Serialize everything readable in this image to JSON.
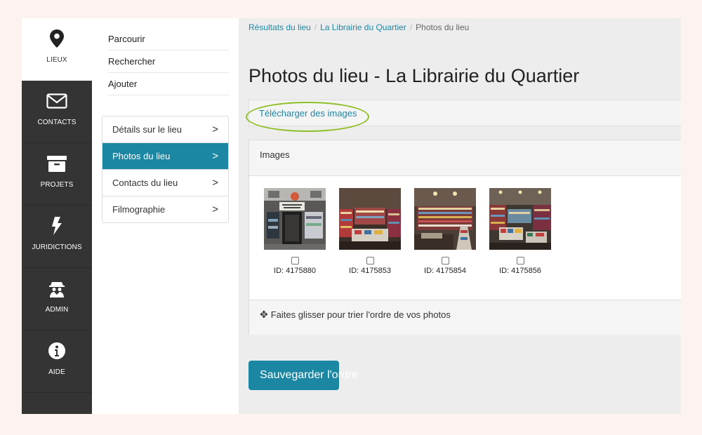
{
  "rail": {
    "items": [
      {
        "label": "LIEUX",
        "icon": "map-pin-icon",
        "active": true
      },
      {
        "label": "CONTACTS",
        "icon": "envelope-icon"
      },
      {
        "label": "PROJETS",
        "icon": "archive-box-icon"
      },
      {
        "label": "JURIDICTIONS",
        "icon": "lightning-bolt-icon"
      },
      {
        "label": "ADMIN",
        "icon": "spy-user-icon"
      },
      {
        "label": "AIDE",
        "icon": "info-circle-icon"
      }
    ]
  },
  "subnav": {
    "top_links": [
      "Parcourir",
      "Rechercher",
      "Ajouter"
    ],
    "menu": [
      {
        "label": "Détails sur le lieu"
      },
      {
        "label": "Photos du lieu",
        "active": true
      },
      {
        "label": "Contacts du lieu"
      },
      {
        "label": "Filmographie"
      }
    ],
    "chevron": ">"
  },
  "breadcrumb": {
    "items": [
      "Résultats du lieu",
      "La Librairie du Quartier",
      "Photos du lieu"
    ],
    "separator": "/"
  },
  "page": {
    "title": "Photos du lieu - La Librairie du Quartier",
    "upload_link": "Télécharger des images",
    "images_heading": "Images",
    "drag_icon": "✥",
    "drag_hint": "Faites glisser pour trier l'ordre de vos photos",
    "save_label": "Sauvegarder l'ordre"
  },
  "images": [
    {
      "id_label": "ID: 4175880"
    },
    {
      "id_label": "ID: 4175853"
    },
    {
      "id_label": "ID: 4175854"
    },
    {
      "id_label": "ID: 4175856"
    }
  ],
  "colors": {
    "accent": "#1b87a3",
    "rail_bg": "#343434",
    "highlight_ellipse": "#8fbf26",
    "page_bg": "#fcf3f1"
  }
}
